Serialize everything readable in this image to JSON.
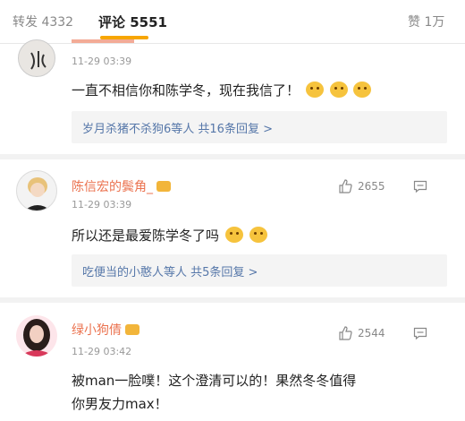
{
  "tabs": {
    "repost": "转发 4332",
    "comments": "评论 5551",
    "likes": "赞 1万"
  },
  "comments": [
    {
      "time": "11-29 03:39",
      "text": "一直不相信你和陈学冬，现在我信了！",
      "reply": "岁月杀猪不杀狗6等人  共16条回复 >"
    },
    {
      "name": "陈信宏的鬓角_",
      "likes": "2655",
      "time": "11-29 03:39",
      "text": "所以还是最爱陈学冬了吗",
      "reply": "吃便当的小憨人等人  共5条回复 >"
    },
    {
      "name": "绿小狗倩",
      "likes": "2544",
      "time": "11-29 03:42",
      "text_line1": "被man一脸噗！这个澄清可以的！果然冬冬值得",
      "text_line2": "你男友力max！"
    }
  ]
}
